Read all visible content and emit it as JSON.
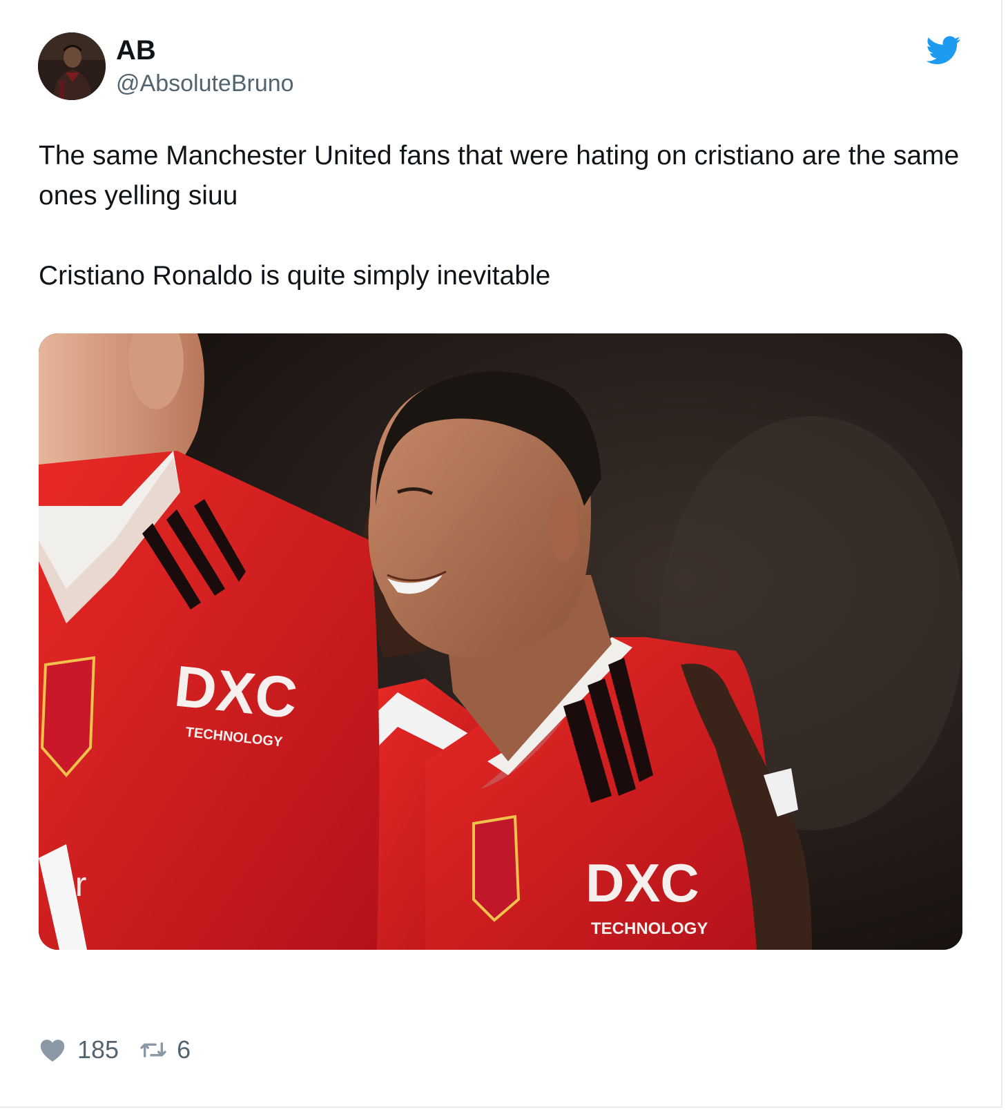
{
  "tweet": {
    "author": {
      "name": "AB",
      "handle": "@AbsoluteBruno",
      "avatar_icon": "profile-photo-avatar"
    },
    "brand_icon": "twitter-bird-icon",
    "brand_color": "#1d9bf0",
    "text": {
      "paragraph1": "The same Manchester United fans that were hating on cristiano are the same ones yelling siuu",
      "paragraph2": "Cristiano Ronaldo is quite simply inevitable"
    },
    "media": {
      "sponsor_logo": "DXC",
      "sponsor_sub": "TECHNOLOGY",
      "partial_text": "er",
      "kit_color": "#dd1d1f"
    },
    "actions": {
      "like_icon": "heart-icon",
      "like_count": "185",
      "retweet_icon": "retweet-icon",
      "retweet_count": "6"
    }
  }
}
